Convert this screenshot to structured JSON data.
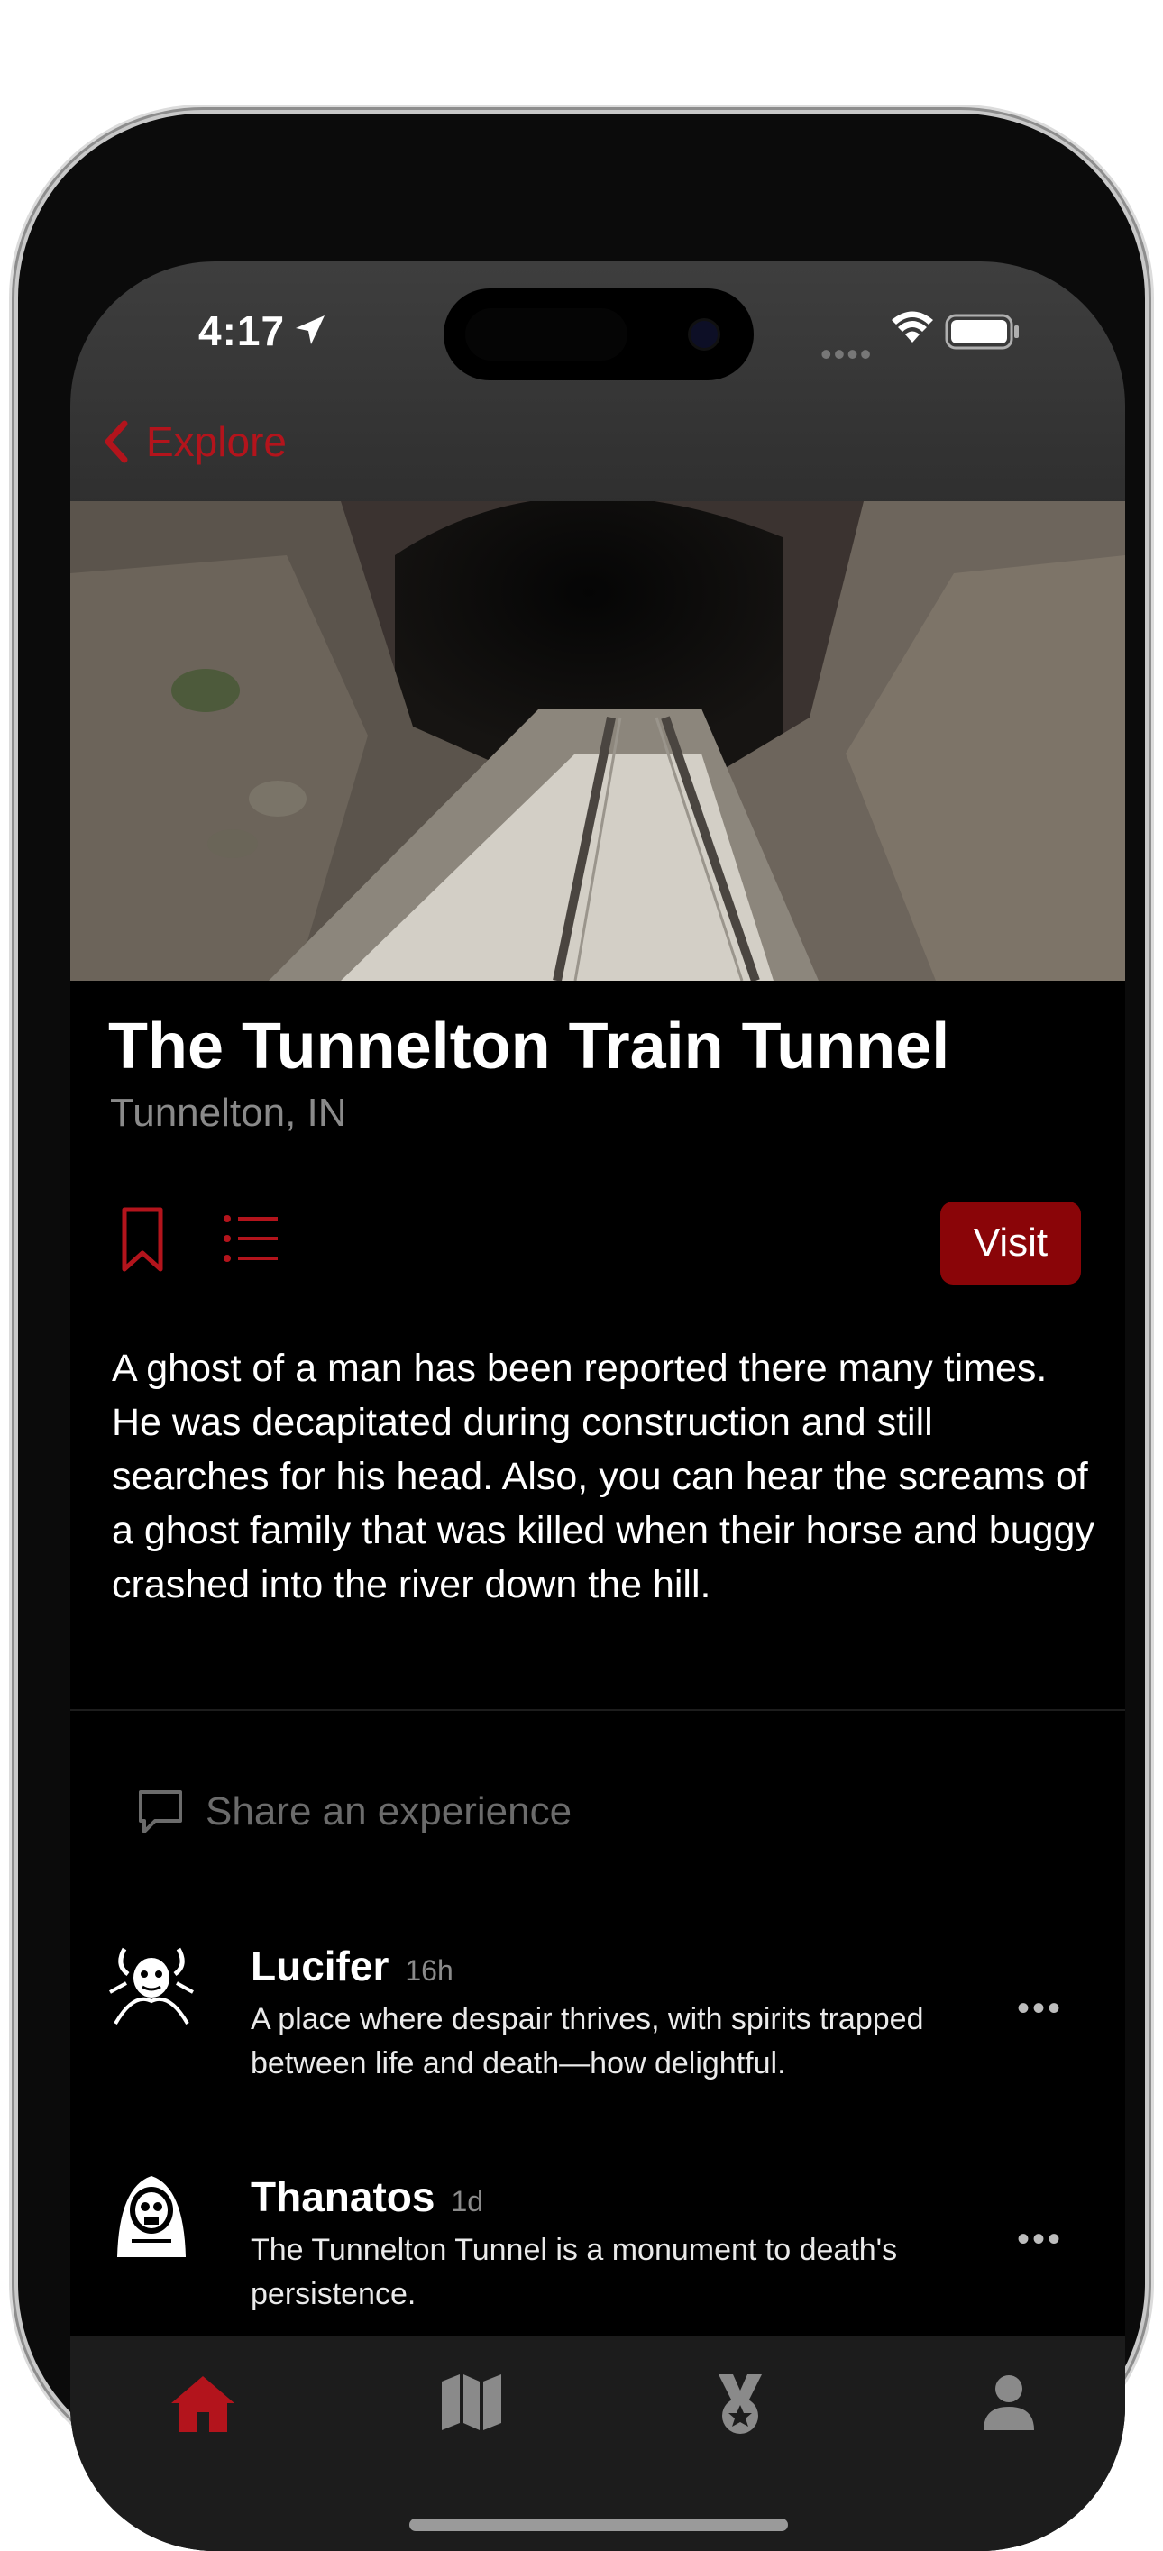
{
  "status_bar": {
    "time": "4:17"
  },
  "nav": {
    "back_label": "Explore"
  },
  "place": {
    "title": "The Tunnelton Train Tunnel",
    "location": "Tunnelton, IN",
    "visit_label": "Visit",
    "description": "A ghost of a man has been reported there many times. He was decapitated during construction and still searches for his head. Also, you can hear the screams of a ghost family that was killed when their horse and buggy crashed into the river down the hill."
  },
  "share": {
    "placeholder": "Share an experience"
  },
  "posts": [
    {
      "name": "Lucifer",
      "age": "16h",
      "text": "A place where despair thrives, with spirits trapped between life and death—how delightful.",
      "more": "•••"
    },
    {
      "name": "Thanatos",
      "age": "1d",
      "text": "The Tunnelton Tunnel is a monument to death's persistence.",
      "more": "•••"
    }
  ],
  "tabs": [
    {
      "icon": "home-icon",
      "active": true
    },
    {
      "icon": "map-icon",
      "active": false
    },
    {
      "icon": "medal-icon",
      "active": false
    },
    {
      "icon": "profile-icon",
      "active": false
    }
  ],
  "colors": {
    "accent": "#b3141c",
    "button": "#8a0508",
    "background": "#000000",
    "tabbar": "#1c1c1c"
  }
}
